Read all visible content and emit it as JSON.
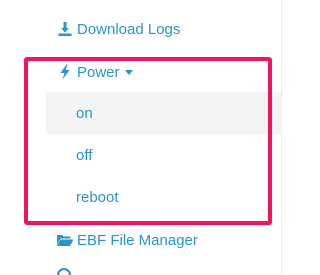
{
  "menu": {
    "download_logs": {
      "label": "Download Logs",
      "icon": "download-icon"
    },
    "power": {
      "label": "Power",
      "icon": "lightning-icon",
      "expanded": true,
      "submenu": [
        {
          "label": "on",
          "hovered": true
        },
        {
          "label": "off",
          "hovered": false
        },
        {
          "label": "reboot",
          "hovered": false
        }
      ]
    },
    "ebf_file_manager": {
      "label": "EBF File Manager",
      "icon": "folder-open-icon"
    }
  },
  "colors": {
    "link": "#2a93c9",
    "highlight_border": "#ee1558",
    "hover_background": "#f4f4f4"
  }
}
